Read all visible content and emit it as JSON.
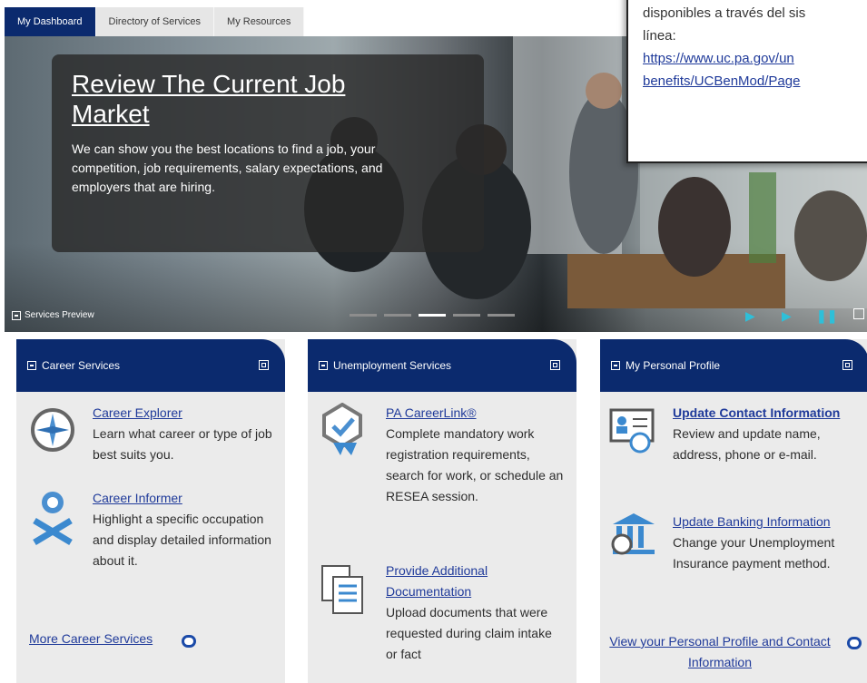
{
  "tabs": [
    {
      "label": "My Dashboard",
      "active": true
    },
    {
      "label": "Directory of Services",
      "active": false
    },
    {
      "label": "My Resources",
      "active": false
    }
  ],
  "hero": {
    "title": "Review The Current Job Market",
    "text": "We can show you the best locations to find a job, your competition, job requirements, salary expectations, and employers that are hiring.",
    "preview_label": "Services Preview",
    "slides_total": 5,
    "slide_active_index": 2
  },
  "popup": {
    "line1": "disponibles a través del sis",
    "line2": "línea:",
    "url1": "https://www.uc.pa.gov/un",
    "url2": "benefits/UCBenMod/Page"
  },
  "cards": {
    "career": {
      "title": "Career Services",
      "items": [
        {
          "link": "Career Explorer",
          "desc": "Learn what career or type of job best suits you."
        },
        {
          "link": "Career Informer",
          "desc": "Highlight a specific occupation and display detailed information about it."
        }
      ],
      "more": "More Career Services"
    },
    "unemployment": {
      "title": "Unemployment Services",
      "items": [
        {
          "link": "PA CareerLink®",
          "desc": "Complete mandatory work registration requirements, search for work, or schedule an RESEA session."
        },
        {
          "link": "Provide Additional Documentation",
          "desc": "Upload documents that were requested during claim intake or fact"
        }
      ]
    },
    "profile": {
      "title": "My Personal Profile",
      "items": [
        {
          "link": "Update Contact Information",
          "desc": "Review and update name, address, phone or e-mail."
        },
        {
          "link": "Update Banking Information",
          "desc": "Change your Unemployment Insurance payment method."
        }
      ],
      "more": "View your Personal Profile and Contact Information"
    }
  },
  "colors": {
    "navy": "#0b2a6e",
    "link": "#1f3a9a",
    "card_bg": "#ebebeb",
    "control_cyan": "#2fbfd8"
  }
}
